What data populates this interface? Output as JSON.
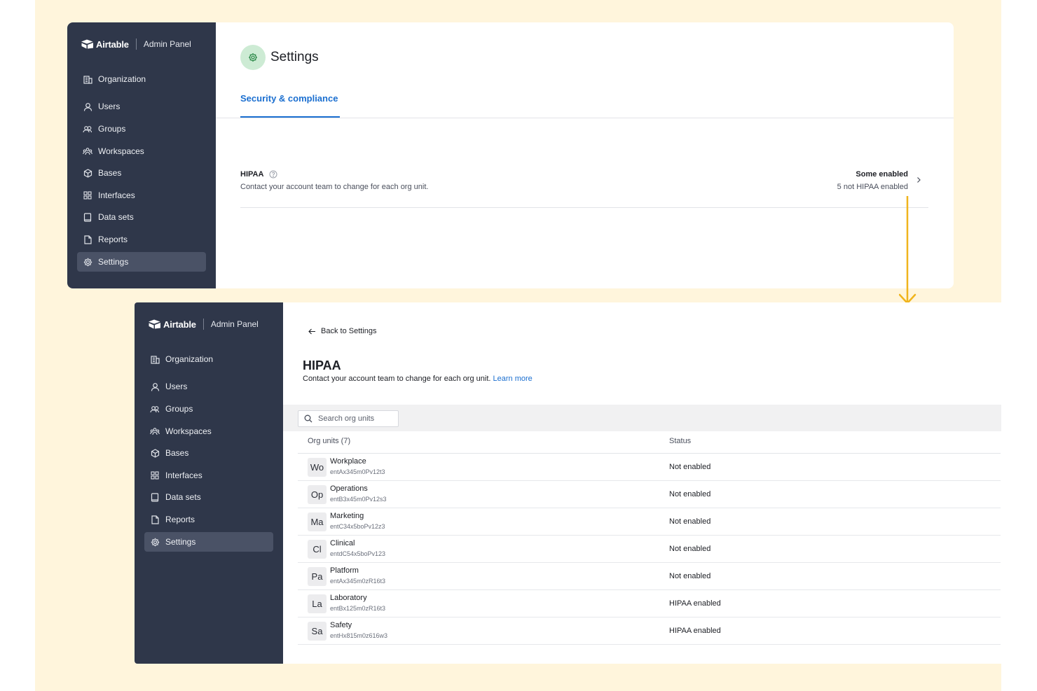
{
  "brand": {
    "logo_text": "Airtable",
    "admin_label": "Admin Panel"
  },
  "nav": [
    {
      "label": "Organization",
      "icon": "building-icon"
    },
    {
      "label": "Users",
      "icon": "user-icon"
    },
    {
      "label": "Groups",
      "icon": "users-icon"
    },
    {
      "label": "Workspaces",
      "icon": "workspace-icon"
    },
    {
      "label": "Bases",
      "icon": "cube-icon"
    },
    {
      "label": "Interfaces",
      "icon": "grid-icon"
    },
    {
      "label": "Data sets",
      "icon": "book-icon"
    },
    {
      "label": "Reports",
      "icon": "file-icon"
    },
    {
      "label": "Settings",
      "icon": "gear-icon",
      "active": true
    }
  ],
  "settings": {
    "title": "Settings",
    "tab": "Security & compliance",
    "hipaa_label": "HIPAA",
    "hipaa_desc": "Contact your account team to change for each org unit.",
    "status_summary": "Some enabled",
    "status_detail": "5 not HIPAA enabled"
  },
  "hipaa_page": {
    "back": "Back to Settings",
    "title": "HIPAA",
    "desc": "Contact your account team to change for each org unit.",
    "learn_more": "Learn more",
    "search_placeholder": "Search org units",
    "col_org_units": "Org units (7)",
    "col_status": "Status",
    "rows": [
      {
        "initials": "Wo",
        "name": "Workplace",
        "id": "entAx345m0Pv12t3",
        "status": "Not enabled"
      },
      {
        "initials": "Op",
        "name": "Operations",
        "id": "entB3x45m0Pv12s3",
        "status": "Not enabled"
      },
      {
        "initials": "Ma",
        "name": "Marketing",
        "id": "entC34x5boPv12z3",
        "status": "Not enabled"
      },
      {
        "initials": "Cl",
        "name": "Clinical",
        "id": "entdC54x5boPv123",
        "status": "Not enabled"
      },
      {
        "initials": "Pa",
        "name": "Platform",
        "id": "entAx345m0zR16t3",
        "status": "Not enabled"
      },
      {
        "initials": "La",
        "name": "Laboratory",
        "id": "entBx125m0zR16t3",
        "status": "HIPAA enabled"
      },
      {
        "initials": "Sa",
        "name": "Safety",
        "id": "entHx815m0z616w3",
        "status": "HIPAA enabled"
      }
    ]
  },
  "colors": {
    "sidebar": "#2f374a",
    "accent": "#1b6fd0",
    "arrow": "#f0b41c",
    "background": "#fff5dc"
  }
}
